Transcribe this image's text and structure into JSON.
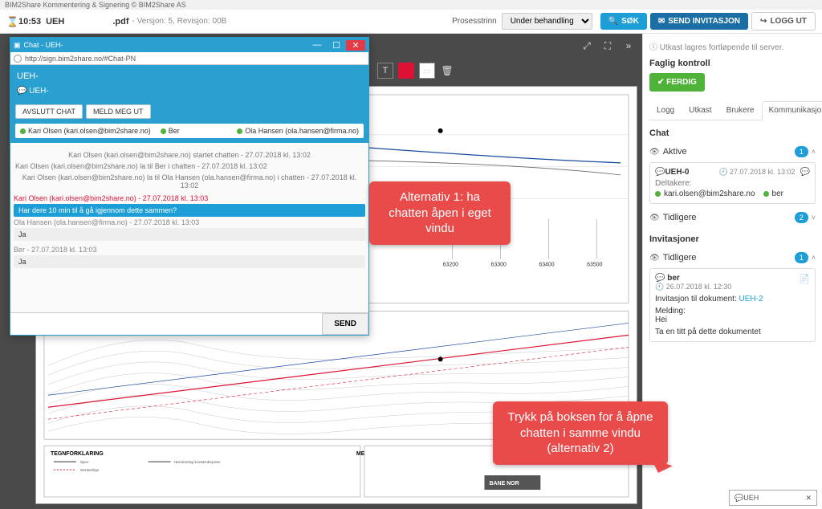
{
  "app": {
    "topline": "BIM2Share Kommentering & Signering © BIM2Share AS",
    "hourglass": "⌛",
    "time": "10:53",
    "doc_code": "UEH",
    "doc_ext": ".pdf",
    "version": "- Versjon: 5, Revisjon: 00B",
    "process_label": "Prosesstrinn",
    "process_value": "Under behandling",
    "btn_search": "SØK",
    "btn_invite": "SEND INVITASJON",
    "btn_logout": "LOGG UT"
  },
  "side": {
    "hint": "Utkast lagres fortløpende til server.",
    "fk_title": "Faglig kontroll",
    "ferdig": "FERDIG",
    "tabs": {
      "logg": "Logg",
      "utkast": "Utkast",
      "brukere": "Brukere",
      "komm": "Kommunikasjon"
    },
    "chat_heading": "Chat",
    "active_label": "Aktive",
    "active_badge": "1",
    "chat": {
      "name": "UEH-0",
      "ts": "27.07.2018 kl. 13:02",
      "part_label": "Deltakere:",
      "p1": "kari.olsen@bim2share.no",
      "p2": "ber"
    },
    "tidligere": "Tidligere",
    "tidligere_badge": "2",
    "inv_heading": "Invitasjoner",
    "inv_tidligere": "Tidligere",
    "inv_badge": "1",
    "inv": {
      "name": "ber",
      "ts": "26.07.2018 kl. 12:30",
      "doc_label": "Invitasjon til dokument:",
      "doc_link": "UEH-2",
      "msg_label": "Melding:",
      "msg_greet": "Hei",
      "msg_body": "Ta en titt på dette dokumentet"
    }
  },
  "chatwin": {
    "title_prefix": "Chat - UEH-",
    "url": "http://sign.bim2share.no/#Chat-PN",
    "header_code": "UEH-",
    "header_sub": "UEH-",
    "btn_end": "AVSLUTT CHAT",
    "btn_leave": "MELD MEG UT",
    "users": {
      "u1": "Kari Olsen (kari.olsen@bim2share.no)",
      "u2": "Ber",
      "u3": "Ola Hansen (ola.hansen@firma.no)"
    },
    "log": {
      "l1": "Kari Olsen (kari.olsen@bim2share.no) startet chatten - 27.07.2018 kl. 13:02",
      "l2": "Kari Olsen (kari.olsen@bim2share.no) la til Ber                                                               i chatten - 27.07.2018 kl. 13:02",
      "l3": "Kari Olsen (kari.olsen@bim2share.no) la til Ola Hansen (ola.hansen@firma.no) i chatten - 27.07.2018 kl. 13:02",
      "m1_hdr": "Kari Olsen (kari.olsen@bim2share.no) - 27.07.2018 kl. 13:03",
      "m1": "Har dere 10 min til å gå igjennom dette sammen?",
      "r1_hdr": "Ola Hansen (ola.hansen@firma.no) - 27.07.2018 kl. 13:03",
      "r1": "Ja",
      "r2_hdr": "Ber                                           - 27.07.2018 kl. 13:03",
      "r2": "Ja"
    },
    "send": "SEND"
  },
  "callouts": {
    "c1": "Alternativ 1: ha chatten åpen i eget vindu",
    "c2": "Trykk på boksen for å åpne chatten i samme vindu (alternativ 2)"
  },
  "bottombox": {
    "label": "UEH"
  },
  "drawing": {
    "ticks": [
      "63200",
      "63300",
      "63400",
      "63500"
    ],
    "legend_title": "TEGNFORKLARING",
    "merknad": "MERKNAD"
  }
}
